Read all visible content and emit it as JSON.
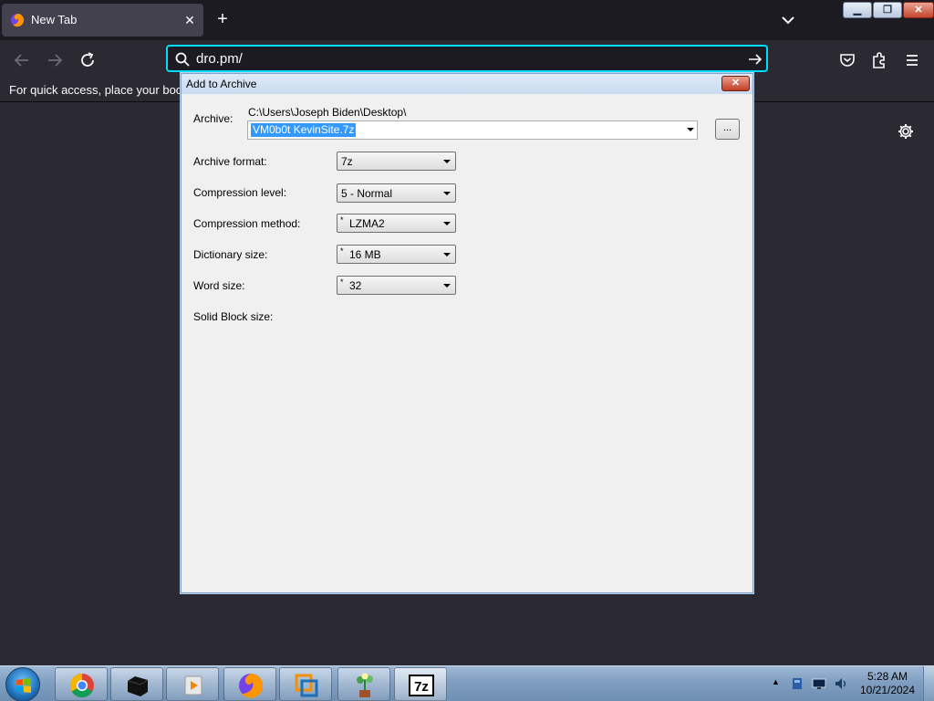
{
  "browser": {
    "tab_title": "New Tab",
    "tab_close_glyph": "✕",
    "new_tab_glyph": "+",
    "url_value": "dro.pm/",
    "bookmarks_hint": "For quick access, place your bookmarks here on the bookmarks toolbar.",
    "accent_color": "#00ddff"
  },
  "window_controls": {
    "minimize_glyph": "▁",
    "maximize_glyph": "❐",
    "close_glyph": "✕"
  },
  "dialog": {
    "title": "Add to Archive",
    "close_glyph": "✕",
    "archive_label": "Archive:",
    "archive_path": "C:\\Users\\Joseph Biden\\Desktop\\",
    "archive_name": "VM0b0t KevinSite.7z",
    "browse_label": "...",
    "fields": [
      {
        "label": "Archive format:",
        "value": "7z",
        "starred": false
      },
      {
        "label": "Compression level:",
        "value": "5 - Normal",
        "starred": false
      },
      {
        "label": "Compression method:",
        "value": "LZMA2",
        "starred": true
      },
      {
        "label": "Dictionary size:",
        "value": "16 MB",
        "starred": true
      },
      {
        "label": "Word size:",
        "value": "32",
        "starred": true
      }
    ],
    "solid_block_label": "Solid Block size:",
    "star_glyph": "*"
  },
  "taskbar": {
    "apps": [
      "chrome-icon",
      "terminal-icon",
      "media-player-icon",
      "firefox-icon",
      "vmware-icon",
      "plant-icon",
      "7zip-icon"
    ],
    "tray_expand_glyph": "▲",
    "time": "5:28 AM",
    "date": "10/21/2024"
  }
}
